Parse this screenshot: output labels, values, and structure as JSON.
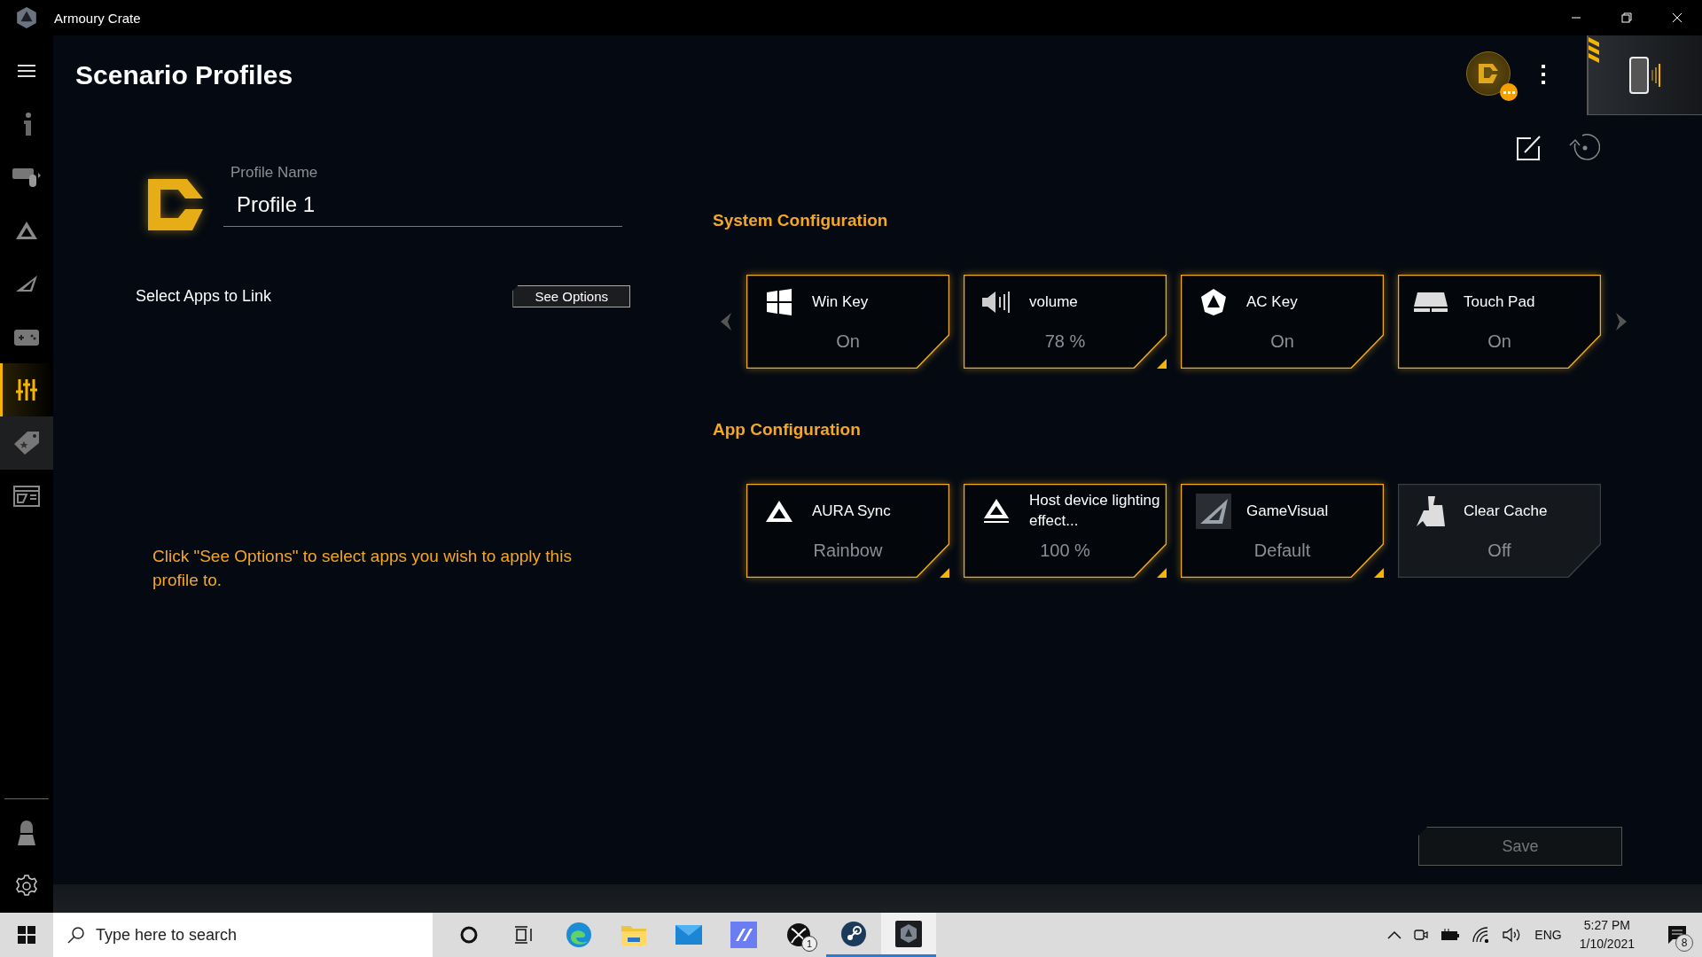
{
  "window": {
    "title": "Armoury Crate"
  },
  "sidebar": {
    "items": [
      {
        "selected": false,
        "hovered": false
      },
      {
        "selected": false,
        "hovered": false
      },
      {
        "selected": false,
        "hovered": false
      },
      {
        "selected": false,
        "hovered": false
      },
      {
        "selected": false,
        "hovered": false
      },
      {
        "selected": true,
        "hovered": false
      },
      {
        "selected": false,
        "hovered": true
      },
      {
        "selected": false,
        "hovered": false
      }
    ]
  },
  "page": {
    "title": "Scenario Profiles"
  },
  "profile": {
    "name_label": "Profile Name",
    "name_value": "Profile 1"
  },
  "apps_link": {
    "label": "Select Apps to Link",
    "button": "See Options"
  },
  "hint": "Click \"See Options\" to select apps you wish to apply this profile to.",
  "system_configuration": {
    "title": "System Configuration",
    "cards": [
      {
        "label": "Win Key",
        "value": "On",
        "active": true,
        "adjustable": false
      },
      {
        "label": "volume",
        "value": "78 %",
        "active": true,
        "adjustable": true
      },
      {
        "label": "AC Key",
        "value": "On",
        "active": true,
        "adjustable": false
      },
      {
        "label": "Touch Pad",
        "value": "On",
        "active": true,
        "adjustable": false
      }
    ]
  },
  "app_configuration": {
    "title": "App Configuration",
    "cards": [
      {
        "label": "AURA Sync",
        "value": "Rainbow",
        "active": true,
        "adjustable": true
      },
      {
        "label": "Host device lighting effect...",
        "value": "100 %",
        "active": true,
        "adjustable": true
      },
      {
        "label": "GameVisual",
        "value": "Default",
        "active": true,
        "adjustable": true
      },
      {
        "label": "Clear Cache",
        "value": "Off",
        "active": false,
        "adjustable": false
      }
    ]
  },
  "save_button": {
    "label": "Save",
    "disabled": true
  },
  "taskbar": {
    "search": {
      "placeholder": "Type here to search"
    },
    "apps": [
      {
        "running": false,
        "selected": false
      },
      {
        "running": false,
        "selected": false
      },
      {
        "running": false,
        "selected": false
      },
      {
        "running": false,
        "selected": false
      },
      {
        "running": false,
        "selected": false
      },
      {
        "running": false,
        "selected": false
      },
      {
        "running": false,
        "selected": false,
        "badge": "1"
      },
      {
        "running": true,
        "selected": false
      },
      {
        "running": true,
        "selected": true
      }
    ],
    "tray": {
      "language": "ENG",
      "time": "5:27 PM",
      "date": "1/10/2021",
      "notification_count": "8"
    }
  }
}
